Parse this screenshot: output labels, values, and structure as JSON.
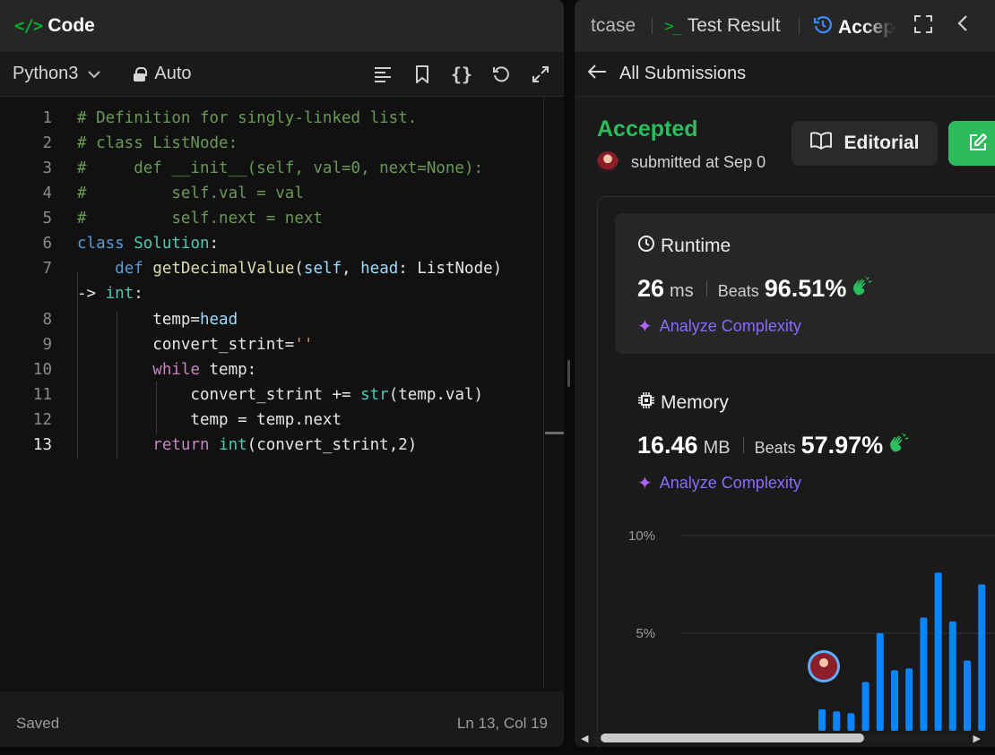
{
  "editor": {
    "header_title": "Code",
    "language": "Python3",
    "mode": "Auto",
    "status_saved": "Saved",
    "cursor_position": "Ln 13, Col 19",
    "line_numbers": [
      "1",
      "2",
      "3",
      "4",
      "5",
      "6",
      "7",
      "",
      "8",
      "9",
      "10",
      "11",
      "12",
      "13"
    ],
    "code_lines": [
      "# Definition for singly-linked list.",
      "# class ListNode:",
      "#     def __init__(self, val=0, next=None):",
      "#         self.val = val",
      "#         self.next = next",
      "class Solution:",
      "    def getDecimalValue(self, head: ListNode)",
      "-> int:",
      "        temp=head",
      "        convert_strint=''",
      "        while temp:",
      "            convert_strint += str(temp.val)",
      "            temp = temp.next",
      "        return int(convert_strint,2)"
    ]
  },
  "results": {
    "tabs": {
      "testcase": "tcase",
      "test_result": "Test Result",
      "accepted": "Accep"
    },
    "back_label": "All Submissions",
    "status": "Accepted",
    "submitted_text": "submitted at Sep 0",
    "editorial_label": "Editorial",
    "runtime": {
      "label": "Runtime",
      "value": "26",
      "unit": "ms",
      "beats_label": "Beats",
      "beats_pct": "96.51%",
      "analyze_label": "Analyze Complexity"
    },
    "memory": {
      "label": "Memory",
      "value": "16.46",
      "unit": "MB",
      "beats_label": "Beats",
      "beats_pct": "57.97%",
      "analyze_label": "Analyze Complexity"
    }
  },
  "colors": {
    "accepted_green": "#2cbb5d",
    "bar_blue": "#0a84ff",
    "analyze_purple": "#8a6bff"
  },
  "chart_data": {
    "type": "bar",
    "y_tick_labels": [
      "10%",
      "5%"
    ],
    "y_ticks": [
      10,
      5
    ],
    "ylim": [
      0,
      10
    ],
    "values": [
      1.1,
      1.0,
      0.9,
      2.5,
      5.0,
      3.1,
      3.2,
      5.8,
      8.1,
      5.6,
      3.6,
      7.5
    ],
    "highlight_index": 0
  }
}
